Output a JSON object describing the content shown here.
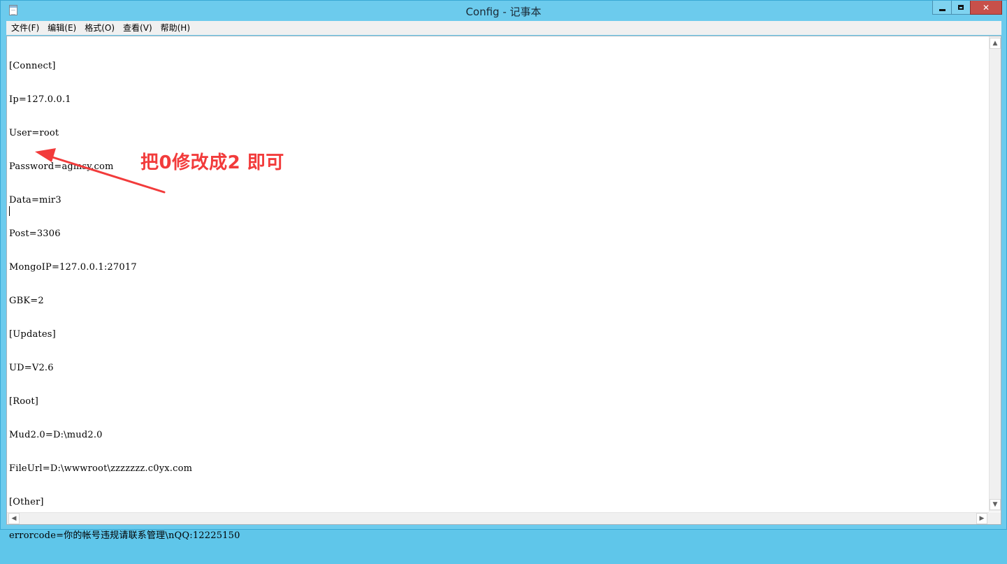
{
  "window": {
    "title": "Config - 记事本",
    "controls": {
      "minimize": "–",
      "maximize": "□",
      "close": "✕"
    }
  },
  "menu": {
    "items": [
      "文件(F)",
      "编辑(E)",
      "格式(O)",
      "查看(V)",
      "帮助(H)"
    ]
  },
  "editor": {
    "lines": [
      "[Connect]",
      "Ip=127.0.0.1",
      "User=root",
      "Password=agmsy.com",
      "Data=mir3",
      "Post=3306",
      "MongoIP=127.0.0.1:27017",
      "GBK=2",
      "[Updates]",
      "UD=V2.6",
      "[Root]",
      "Mud2.0=D:\\mud2.0",
      "FileUrl=D:\\wwwroot\\zzzzzzz.c0yx.com",
      "[Other]",
      "errorcode=你的帐号违规请联系管理\\nQQ:12225150"
    ]
  },
  "annotation": {
    "text": "把0修改成2 即可",
    "color": "#f23b3b"
  },
  "scrollbars": {
    "up": "▲",
    "down": "▼",
    "left": "◀",
    "right": "▶"
  },
  "icons": {
    "app": "notepad-icon"
  }
}
